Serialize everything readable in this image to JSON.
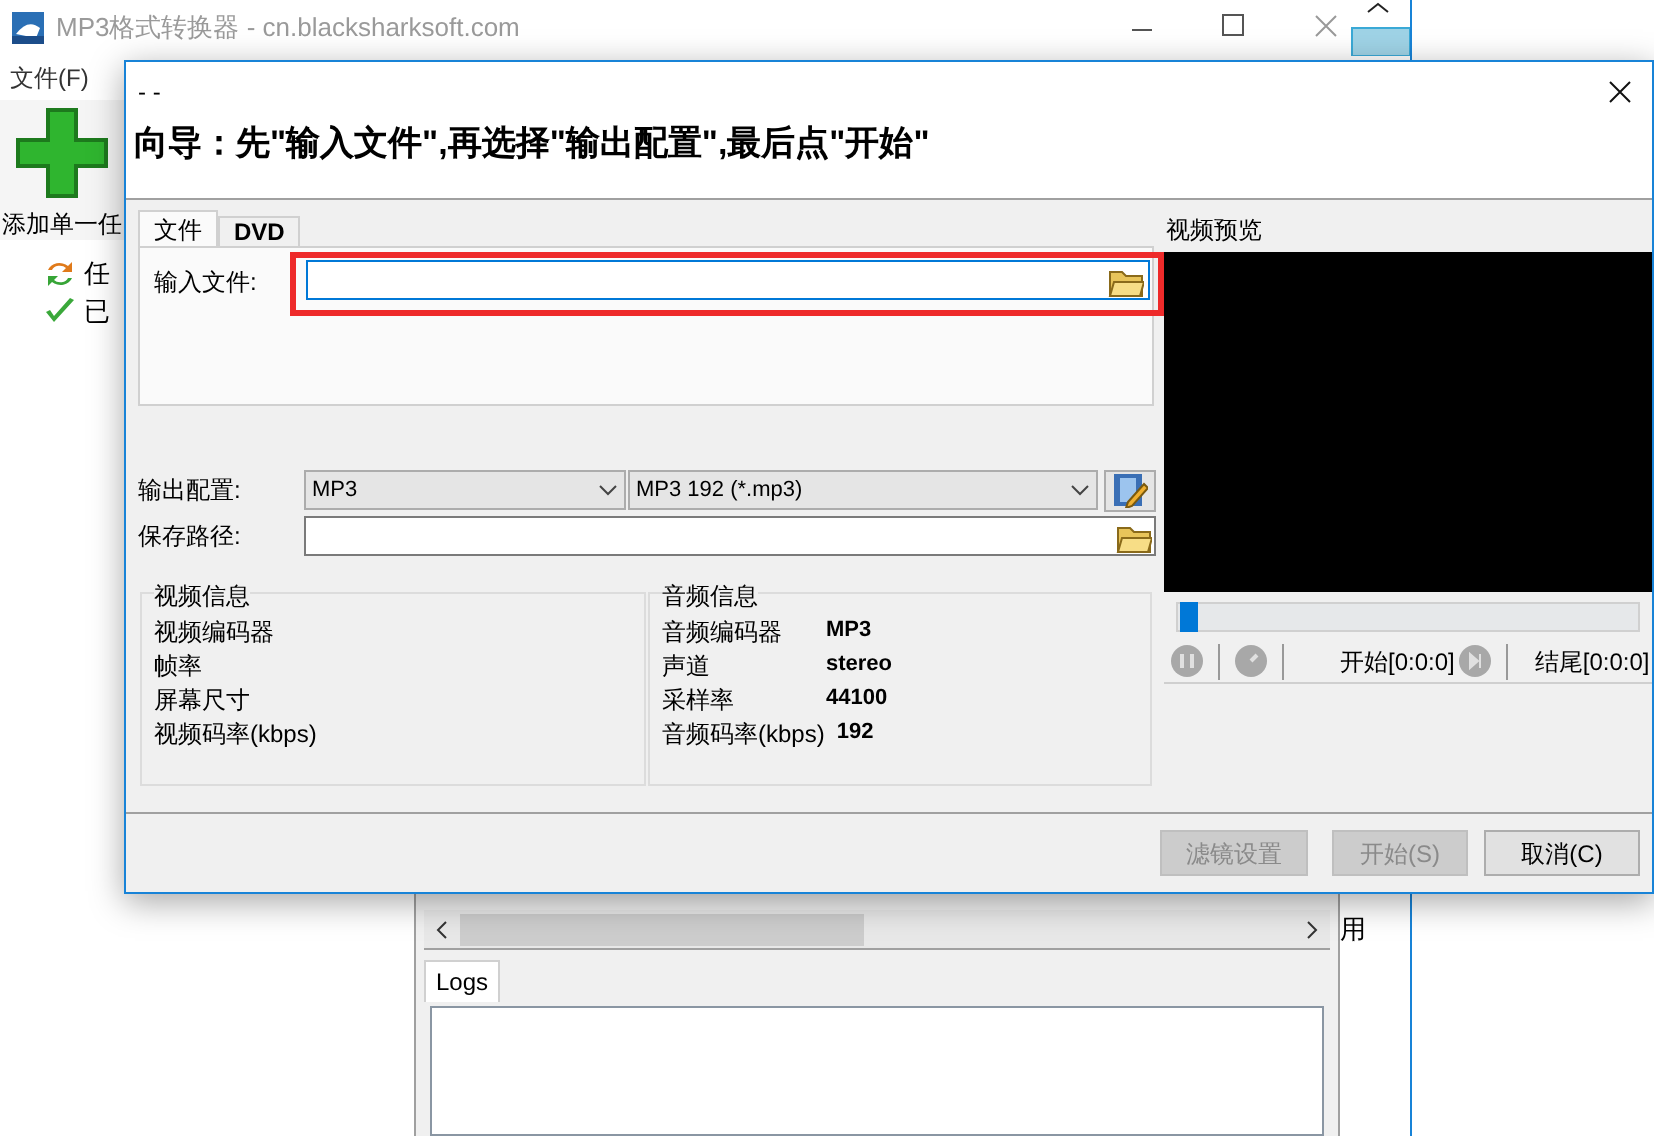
{
  "app_window": {
    "title": "MP3格式转换器 - cn.blacksharksoft.com",
    "menu": [
      "文件(F)"
    ],
    "toolbar": [
      {
        "label": "添加单一任"
      }
    ],
    "tree": [
      {
        "label": "任",
        "kind": "tasks"
      },
      {
        "label": "已",
        "kind": "done"
      }
    ],
    "side_text": "用",
    "log_tabs": [
      {
        "label": "Logs",
        "selected": true
      }
    ]
  },
  "dialog": {
    "title": "- -",
    "heading": "向导：先\"输入文件\",再选择\"输出配置\",最后点\"开始\"",
    "tabs": [
      {
        "label": "文件",
        "selected": true
      },
      {
        "label": "DVD",
        "selected": false
      }
    ],
    "input_file": {
      "label": "输入文件:"
    },
    "output_config": {
      "label": "输出配置:",
      "format": "MP3",
      "profile": "MP3 192 (*.mp3)"
    },
    "save_path": {
      "label": "保存路径:"
    },
    "video_info": {
      "title": "视频信息",
      "rows": [
        {
          "label": "视频编码器"
        },
        {
          "label": "帧率"
        },
        {
          "label": "屏幕尺寸"
        },
        {
          "label": "视频码率(kbps)"
        }
      ]
    },
    "audio_info": {
      "title": "音频信息",
      "rows": [
        {
          "label": "音频编码器",
          "value": "MP3"
        },
        {
          "label": "声道",
          "value": "stereo"
        },
        {
          "label": "采样率",
          "value": "44100"
        },
        {
          "label": "音频码率(kbps)",
          "value": "192"
        }
      ]
    },
    "preview": {
      "title": "视频预览",
      "position": {
        "level": 0
      },
      "start": "开始[0:0:0]",
      "end": "结尾[0:0:0]"
    },
    "buttons": [
      {
        "label": "滤镜设置",
        "disabled": true
      },
      {
        "label": "开始(S)",
        "disabled": true
      },
      {
        "label": "取消(C)",
        "disabled": false
      }
    ]
  }
}
